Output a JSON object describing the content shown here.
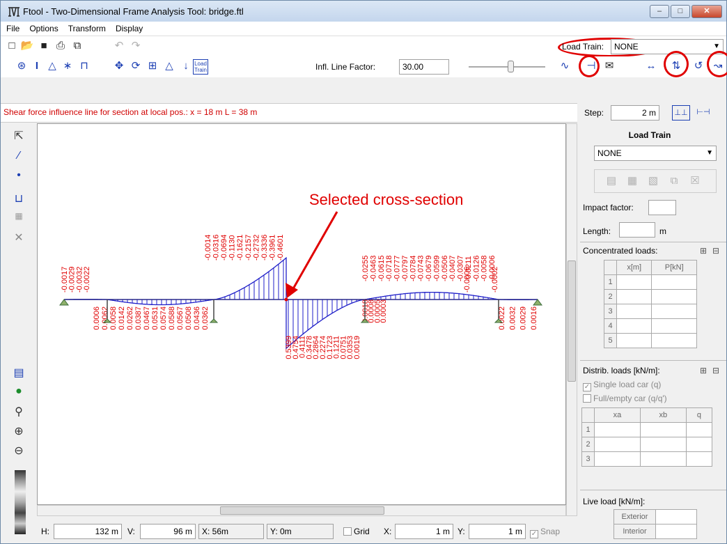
{
  "window": {
    "title": "Ftool - Two-Dimensional Frame Analysis Tool: bridge.ftl"
  },
  "menu": [
    "File",
    "Options",
    "Transform",
    "Display"
  ],
  "toolbar": {
    "load_train_label": "Load Train:",
    "load_train_value": "NONE",
    "infl_label": "Infl. Line Factor:",
    "infl_value": "30.00",
    "load_train_button": "Load Train"
  },
  "status_line": "Shear force influence line for section at local pos.: x = 18 m  L = 38 m",
  "step": {
    "label": "Step:",
    "value": "2 m"
  },
  "canvas": {
    "annotation": "Selected cross-section",
    "accent_color": "#e00000",
    "line_color": "#1c1cc8",
    "labels_left_up": [
      "-0.0017",
      "-0.0029",
      "-0.0032",
      "-0.0022"
    ],
    "labels_left_down": [
      "0.0006",
      "0.0062",
      "0.0058",
      "0.0142",
      "0.0262",
      "0.0387",
      "0.0467",
      "0.0531",
      "0.0574",
      "0.0588",
      "0.0567",
      "0.0508",
      "0.0436",
      "0.0362"
    ],
    "labels_mid_up": [
      "-0.0014",
      "-0.0316",
      "-0.0694",
      "-0.1130",
      "-0.1621",
      "-0.2157",
      "-0.2732",
      "-0.3336",
      "-0.3961",
      "-0.4601"
    ],
    "labels_mid_down": [
      "0.5399",
      "0.4754",
      "0.4111",
      "0.3478",
      "0.2864",
      "0.2274",
      "0.1723",
      "0.1211",
      "0.0751",
      "0.0353",
      "0.0019"
    ],
    "labels_right_up": [
      "-0.0255",
      "-0.0463",
      "-0.0615",
      "-0.0718",
      "-0.0777",
      "-0.0797",
      "-0.0784",
      "-0.0743",
      "-0.0679",
      "-0.0599",
      "-0.0506",
      "-0.0407",
      "-0.0307",
      "-0.0211",
      "-0.0126",
      "-0.0058",
      "-0.0006"
    ],
    "labels_right_small": [
      "0.0018",
      "0.0008",
      "0.0005",
      "0.0003"
    ],
    "labels_far_right_up": [
      "-0.0006",
      "-0.0002"
    ],
    "labels_far_right_down": [
      "0.0022",
      "0.0032",
      "0.0029",
      "0.0016"
    ]
  },
  "bottom": {
    "h_label": "H:",
    "h_value": "132",
    "h_unit": "m",
    "v_label": "V:",
    "v_value": "96",
    "v_unit": "m",
    "x_readout": "X: 56m",
    "y_readout": "Y: 0m",
    "grid_label": "Grid",
    "gx_label": "X:",
    "gx_value": "1",
    "gx_unit": "m",
    "gy_label": "Y:",
    "gy_value": "1",
    "gy_unit": "m",
    "snap_label": "Snap"
  },
  "right_panel": {
    "title": "Load Train",
    "select_value": "NONE",
    "impact_label": "Impact factor:",
    "length_label": "Length:",
    "length_unit": "m",
    "conc_label": "Concentrated loads:",
    "conc_headers": [
      "x[m]",
      "P[kN]"
    ],
    "conc_rows": [
      "1",
      "2",
      "3",
      "4",
      "5"
    ],
    "distrib_label": "Distrib. loads [kN/m]:",
    "single_car": "Single load car (q)",
    "full_empty": "Full/empty car (q/q')",
    "distrib_headers": [
      "xa",
      "xb",
      "q"
    ],
    "distrib_rows": [
      "1",
      "2",
      "3"
    ],
    "live_label": "Live load [kN/m]:",
    "live_rows": [
      "Exterior",
      "Interior"
    ]
  }
}
